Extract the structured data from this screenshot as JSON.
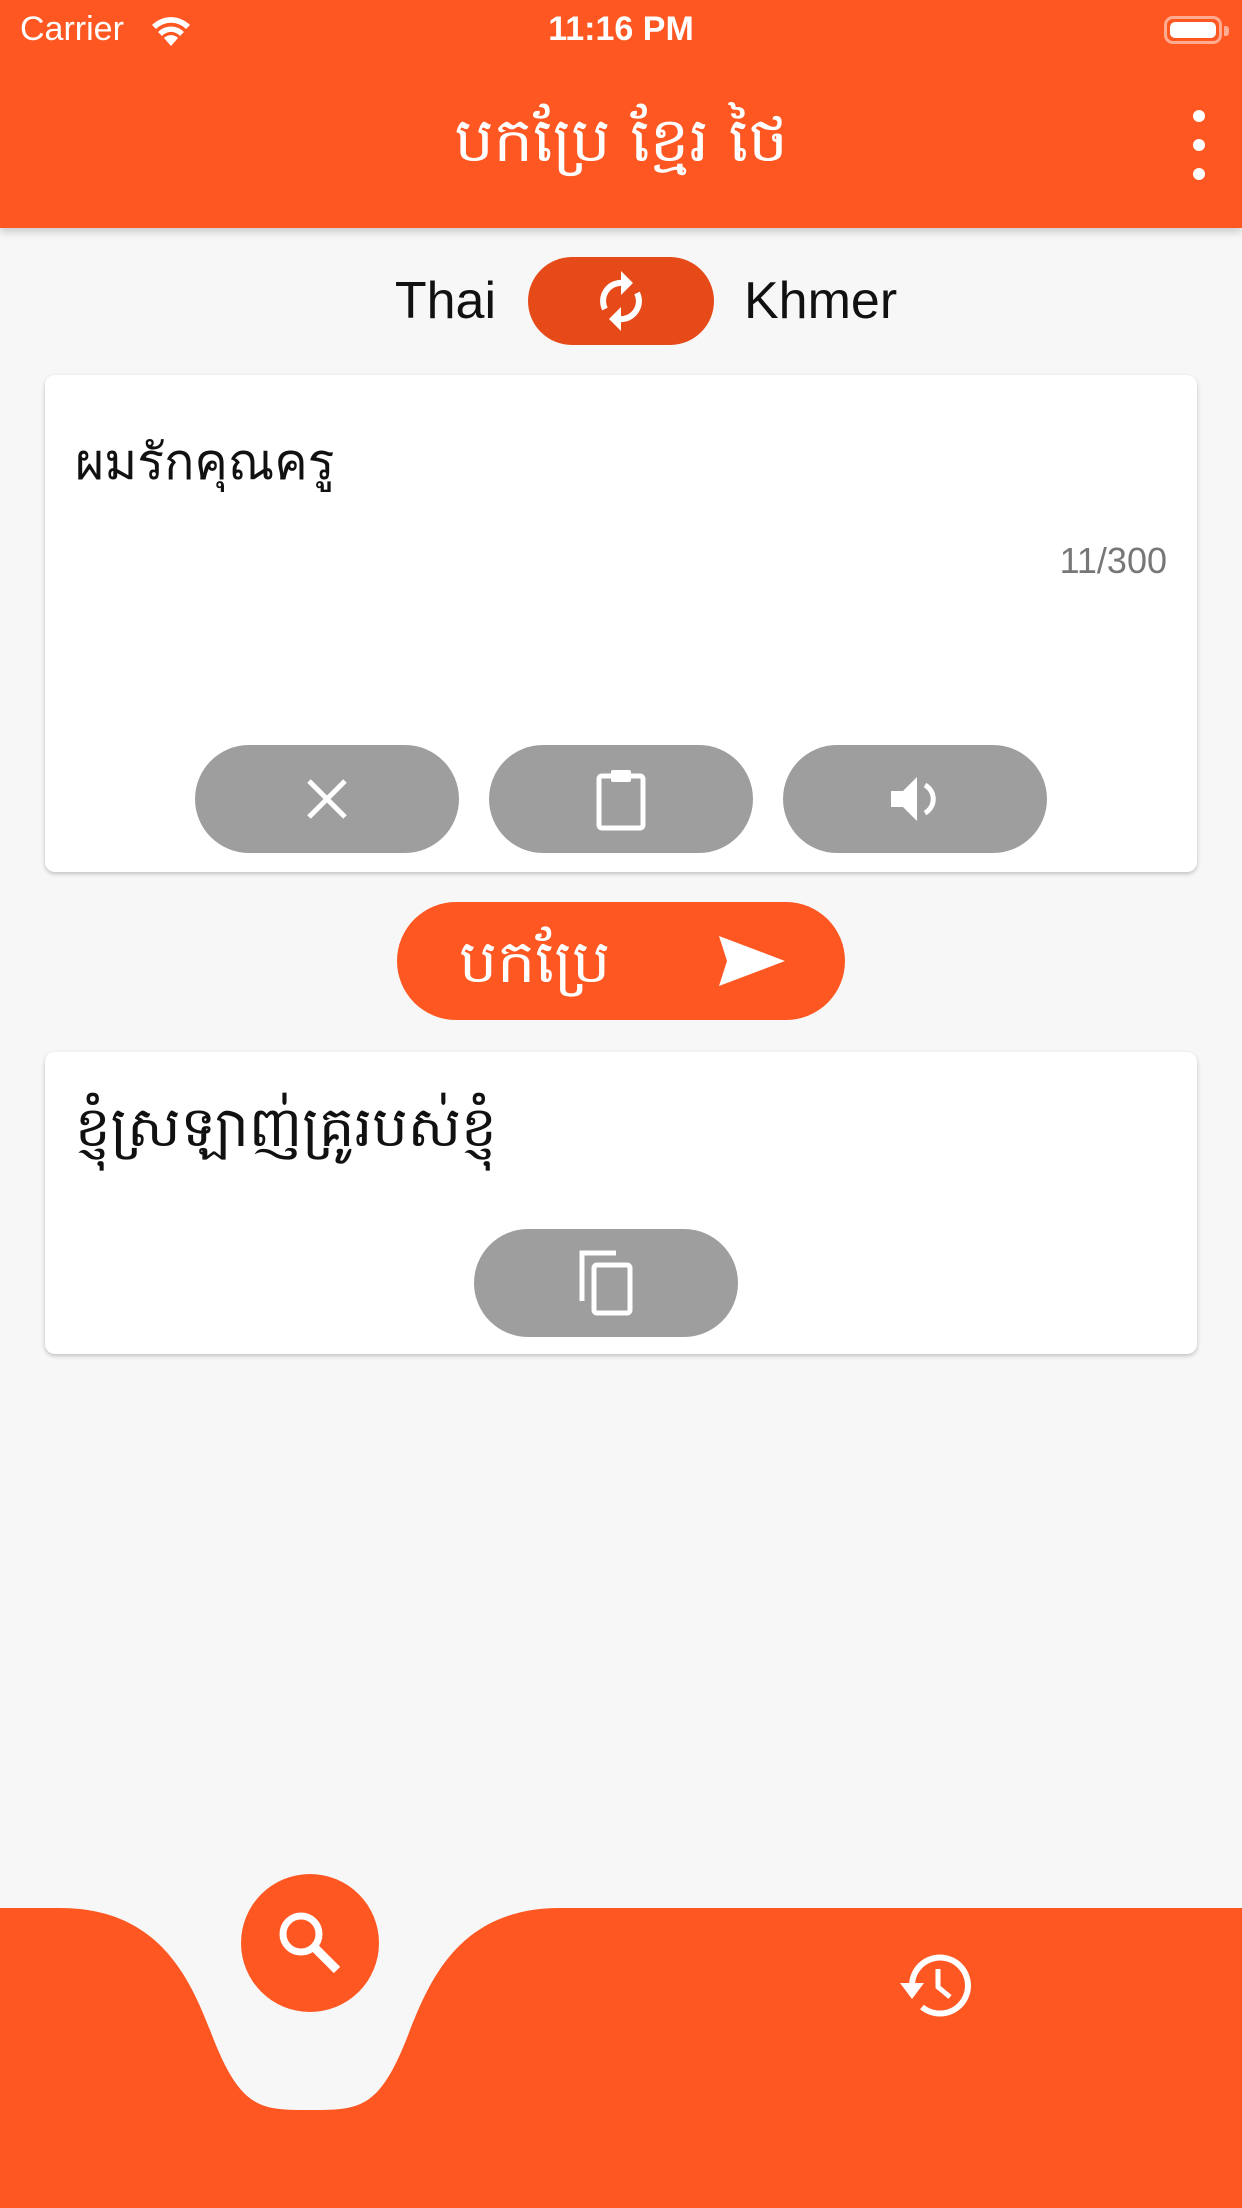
{
  "status_bar": {
    "carrier": "Carrier",
    "time": "11:16 PM"
  },
  "app_bar": {
    "title": "បកប្រែ ខ្មែរ ថៃ",
    "menu_icon": "more-vertical-icon"
  },
  "language_switch": {
    "source": "Thai",
    "target": "Khmer",
    "swap_icon": "swap-sync-icon"
  },
  "input_card": {
    "text": "ผมรักคุณครู",
    "counter": "11/300",
    "actions": [
      {
        "name": "clear",
        "icon": "close-icon"
      },
      {
        "name": "paste",
        "icon": "clipboard-icon"
      },
      {
        "name": "speak",
        "icon": "volume-icon"
      }
    ]
  },
  "translate_button": {
    "label": "បកប្រែ",
    "icon": "send-icon"
  },
  "output_card": {
    "text": "ខ្ញុំស្រឡាញ់គ្រូរបស់ខ្ញុំ",
    "copy_icon": "copy-icon"
  },
  "bottom_nav": {
    "items": [
      {
        "name": "search",
        "icon": "search-icon",
        "active": true
      },
      {
        "name": "history",
        "icon": "history-icon",
        "active": false
      }
    ]
  },
  "colors": {
    "primary": "#FF5722",
    "primary_dark": "#E64A19",
    "action_gray": "#9E9E9E",
    "background": "#F7F7F7"
  }
}
